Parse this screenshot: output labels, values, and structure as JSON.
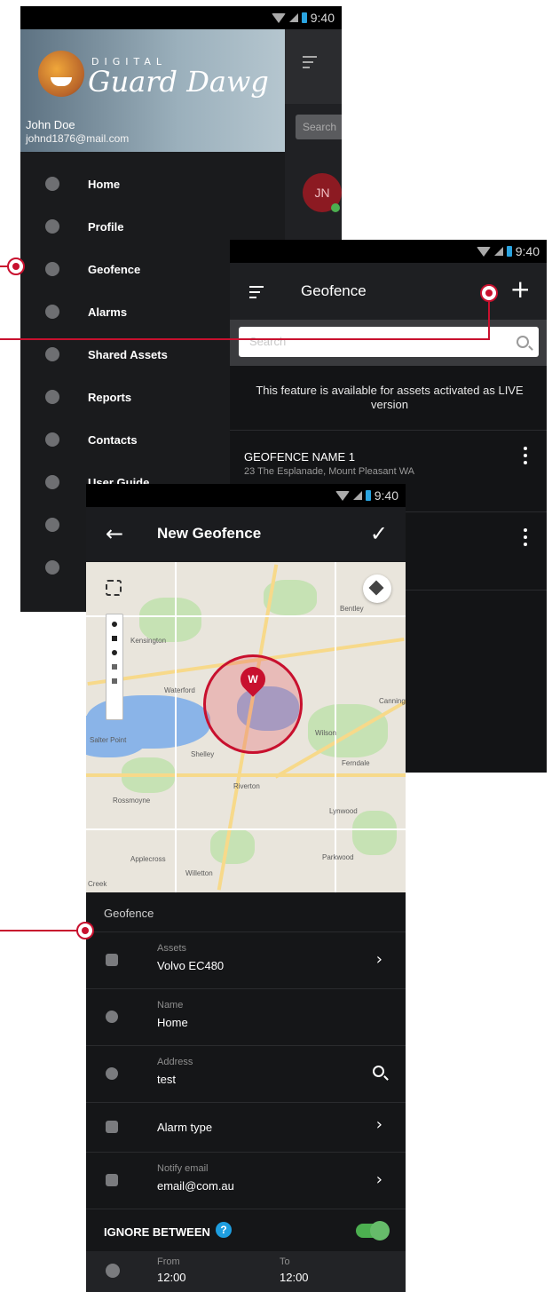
{
  "status_time": "9:40",
  "drawer": {
    "logo_top": "DIGITAL",
    "logo_main": "Guard Dawg",
    "user_name": "John Doe",
    "user_email": "johnd1876@mail.com",
    "menu": [
      {
        "label": "Home",
        "icon": "home-icon"
      },
      {
        "label": "Profile",
        "icon": "gear-icon"
      },
      {
        "label": "Geofence",
        "icon": "geofence-icon"
      },
      {
        "label": "Alarms",
        "icon": "alarm-icon"
      },
      {
        "label": "Shared Assets",
        "icon": "share-icon"
      },
      {
        "label": "Reports",
        "icon": "bar-chart-icon"
      },
      {
        "label": "Contacts",
        "icon": "contacts-icon"
      },
      {
        "label": "User Guide",
        "icon": "document-icon"
      },
      {
        "label": "",
        "icon": "info-icon"
      },
      {
        "label": "",
        "icon": "power-icon"
      }
    ],
    "behind": {
      "search_placeholder": "Search",
      "avatar_initials": "JN"
    }
  },
  "geofence_list": {
    "title": "Geofence",
    "search_placeholder": "Search",
    "notice": "This feature is available for assets activated as LIVE version",
    "items": [
      {
        "name": "GEOFENCE NAME 1",
        "address": "23 The Esplanade, Mount Pleasant WA"
      },
      {
        "name": "",
        "address": ""
      }
    ]
  },
  "new_geofence": {
    "title": "New Geofence",
    "map": {
      "marker_letter": "W",
      "labels": [
        "Bentley",
        "Kensington",
        "Waterford",
        "Salter Point",
        "Shelley",
        "Riverton",
        "Rossmoyne",
        "Ferndale",
        "Lynwood",
        "Parkwood",
        "Willetton",
        "Canning",
        "Wilson",
        "Applecross",
        "Creek"
      ]
    },
    "section_label": "Geofence",
    "fields": {
      "assets_label": "Assets",
      "assets_value": "Volvo EC480",
      "name_label": "Name",
      "name_value": "Home",
      "address_label": "Address",
      "address_value": "test",
      "alarm_label": "Alarm type",
      "email_label": "Notify email",
      "email_value": "email@com.au",
      "ignore_label": "IGNORE BETWEEN",
      "ignore_on": true,
      "from_label": "From",
      "from_value": "12:00",
      "to_label": "To",
      "to_value": "12:00"
    }
  },
  "colors": {
    "accent": "#c8102e",
    "toggle": "#4caf50",
    "help": "#1e9ee0"
  }
}
